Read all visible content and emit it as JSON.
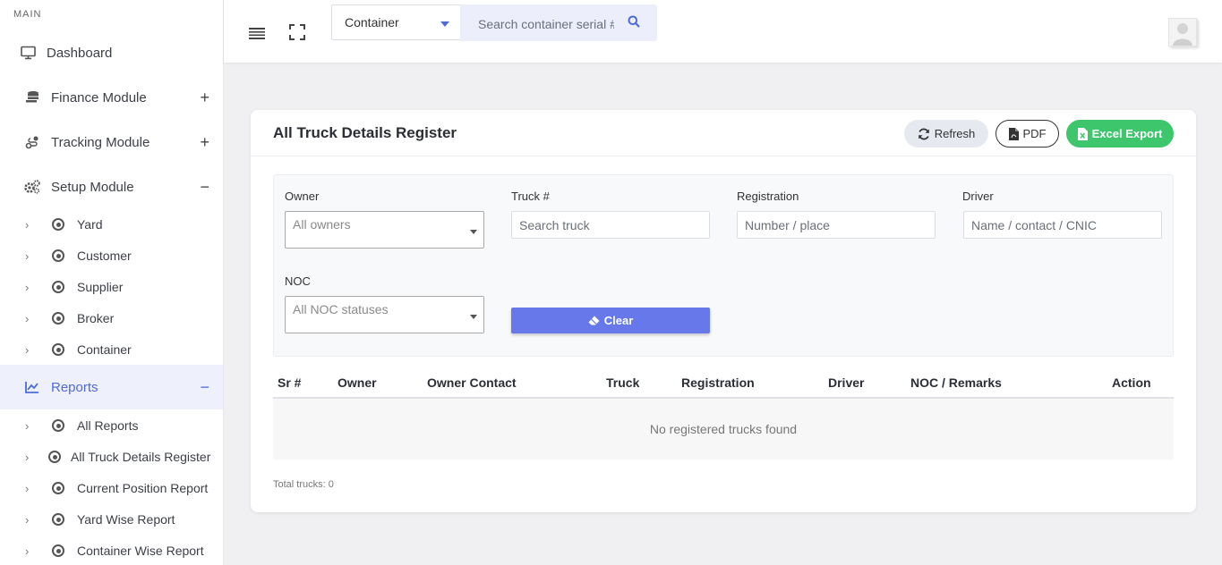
{
  "sidebar": {
    "section_label": "MAIN",
    "items": [
      {
        "label": "Dashboard",
        "icon": "monitor-icon",
        "toggle": ""
      },
      {
        "label": "Finance Module",
        "icon": "coins-icon",
        "toggle": "+"
      },
      {
        "label": "Tracking Module",
        "icon": "route-icon",
        "toggle": "+"
      },
      {
        "label": "Setup Module",
        "icon": "cogs-icon",
        "toggle": "−"
      },
      {
        "label": "Reports",
        "icon": "chart-line-icon",
        "toggle": "−"
      }
    ],
    "setup_children": [
      "Yard",
      "Customer",
      "Supplier",
      "Broker",
      "Container"
    ],
    "report_children": [
      "All Reports",
      "All Truck Details Register",
      "Current Position Report",
      "Yard Wise Report",
      "Container Wise Report"
    ],
    "active_color": "#4e6bd8"
  },
  "topbar": {
    "search_type": "Container",
    "search_placeholder": "Search container serial #"
  },
  "card": {
    "title": "All Truck Details Register",
    "refresh_label": "Refresh",
    "pdf_label": "PDF",
    "excel_label": "Excel Export",
    "excel_color": "#3dc66b"
  },
  "filters": {
    "owner_label": "Owner",
    "owner_value": "All owners",
    "truck_label": "Truck #",
    "truck_placeholder": "Search truck",
    "registration_label": "Registration",
    "registration_placeholder": "Number / place",
    "driver_label": "Driver",
    "driver_placeholder": "Name / contact / CNIC",
    "noc_label": "NOC",
    "noc_value": "All NOC statuses",
    "clear_label": "Clear",
    "clear_color": "#6678ea"
  },
  "table": {
    "columns": [
      "Sr #",
      "Owner",
      "Owner Contact",
      "Truck",
      "Registration",
      "Driver",
      "NOC / Remarks",
      "Action"
    ],
    "empty_message": "No registered trucks found",
    "total_text": "Total trucks: 0"
  }
}
